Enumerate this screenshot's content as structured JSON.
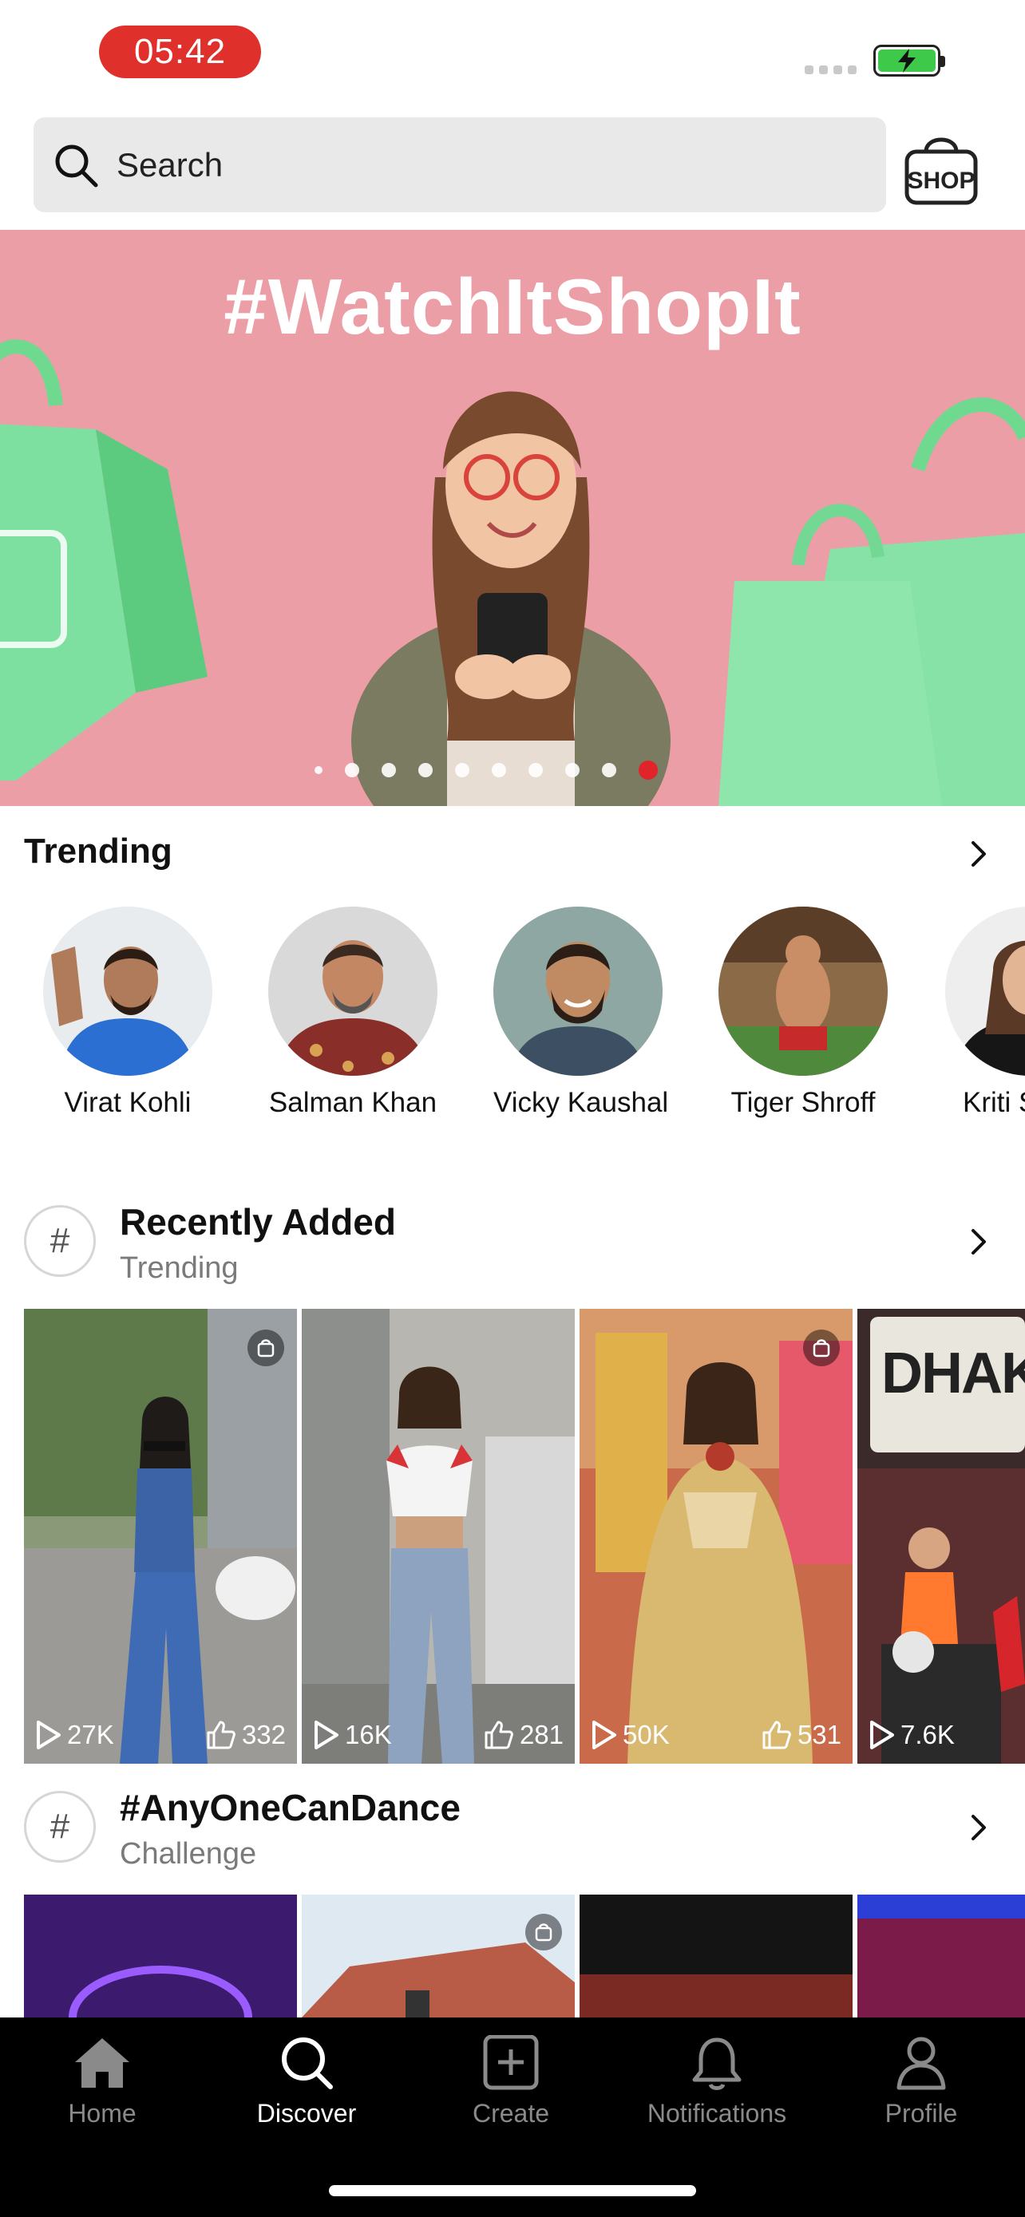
{
  "status_bar": {
    "time": "05:42"
  },
  "search": {
    "placeholder": "Search",
    "shop_label": "SHOP"
  },
  "banner": {
    "title": "#WatchItShopIt",
    "slide_count": 10,
    "active_slide": 10
  },
  "trending": {
    "title": "Trending",
    "people": [
      {
        "name": "Virat Kohli"
      },
      {
        "name": "Salman Khan"
      },
      {
        "name": "Vicky Kaushal"
      },
      {
        "name": "Tiger Shroff"
      },
      {
        "name": "Kriti S"
      }
    ]
  },
  "recently_added": {
    "title": "Recently Added",
    "subtitle": "Trending",
    "tiles": [
      {
        "views": "27K",
        "likes": "332"
      },
      {
        "views": "16K",
        "likes": "281"
      },
      {
        "views": "50K",
        "likes": "531"
      },
      {
        "views": "7.6K",
        "likes": "",
        "overlay_text": "DHAK D"
      }
    ]
  },
  "challenge": {
    "title": "#AnyOneCanDance",
    "subtitle": "Challenge"
  },
  "nav": {
    "items": [
      {
        "label": "Home"
      },
      {
        "label": "Discover"
      },
      {
        "label": "Create"
      },
      {
        "label": "Notifications"
      },
      {
        "label": "Profile"
      }
    ]
  },
  "colors": {
    "accent_red": "#e0242a",
    "banner_pink": "#ec9ea6",
    "nav_bg": "#000000"
  }
}
